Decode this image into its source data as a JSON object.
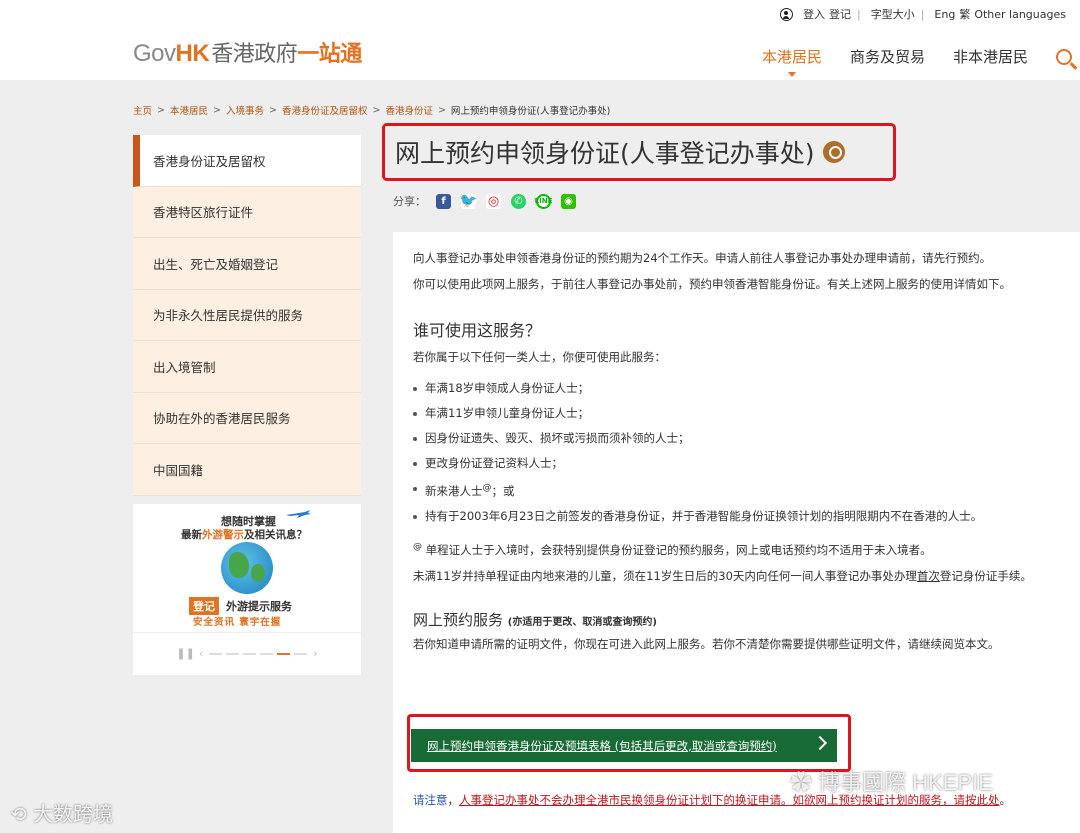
{
  "utility": {
    "login": "登入",
    "register": "登记",
    "font_size": "字型大小",
    "lang_en": "Eng",
    "lang_tc": "繁",
    "other_languages": "Other languages"
  },
  "logo": {
    "gov": "Gov",
    "hk": "HK",
    "cn_a": "香港政府",
    "cn_b": "一站通"
  },
  "nav": {
    "residents": "本港居民",
    "business": "商务及贸易",
    "non_residents": "非本港居民"
  },
  "breadcrumb": {
    "items": [
      "主页",
      "本港居民",
      "入境事务",
      "香港身份证及居留权",
      "香港身份证"
    ],
    "current": "网上预约申领身份证(人事登记办事处)"
  },
  "sidebar": {
    "items": [
      "香港身份证及居留权",
      "香港特区旅行证件",
      "出生、死亡及婚姻登记",
      "为非永久性居民提供的服务",
      "出入境管制",
      "协助在外的香港居民服务",
      "中国国籍"
    ]
  },
  "promo": {
    "line1": "想随时掌握",
    "line2_a": "最新",
    "line2_b": "外游警示",
    "line2_c": "及相关讯息？",
    "register": "登记",
    "service": "外游提示服务",
    "sub": "安全资讯  寰宇在握"
  },
  "page": {
    "title": "网上预约申领身份证(人事登记办事处)",
    "share_label": "分享："
  },
  "content": {
    "p1": "向人事登记办事处申领香港身份证的预约期为24个工作天。申请人前往人事登记办事处办理申请前，请先行预约。",
    "p2": "你可以使用此项网上服务，于前往人事登记办事处前，预约申领香港智能身份证。有关上述网上服务的使用详情如下。",
    "h_who": "谁可使用这服务？",
    "p_who": "若你属于以下任何一类人士，你便可使用此服务：",
    "list": [
      "年满18岁申领成人身份证人士；",
      "年满11岁申领儿童身份证人士；",
      "因身份证遗失、毁灭、损坏或污损而须补领的人士；",
      "更改身份证登记资料人士；",
      "新来港人士",
      "持有于2003年6月23日之前签发的香港身份证，并于香港智能身份证换领计划的指明限期内不在香港的人士。"
    ],
    "list_sup": "@",
    "list_suffix": "；或",
    "fn_sup": "@",
    "fn": " 单程证人士于入境时，会获特别提供身份证登记的预约服务，网上或电话预约均不适用于未入境者。",
    "p_child_a": "未满11岁并持单程证由内地来港的儿童，须在11岁生日后的30天内向任何一间人事登记办事处办理",
    "p_child_u": "首次",
    "p_child_b": "登记身份证手续。",
    "h_online": "网上预约服务",
    "h_online_small": "(亦适用于更改、取消或查询预约)",
    "p_online": "若你知道申请所需的证明文件，你现在可进入此网上服务。若你不清楚你需要提供哪些证明文件，请继续阅览本文。",
    "cta": "网上预约申领香港身份证及预填表格 (包括其后更改,取消或查询预约)",
    "note_label": "请注意",
    "note_sep": "，",
    "note_text": "人事登记办事处不会办理全港市民换领身份证计划下的换证申请。如欲网上预约换证计划的服务，请按此处",
    "note_end": "。"
  },
  "watermarks": {
    "right": "博事國際 HKEPIE",
    "left": "大数跨境"
  }
}
